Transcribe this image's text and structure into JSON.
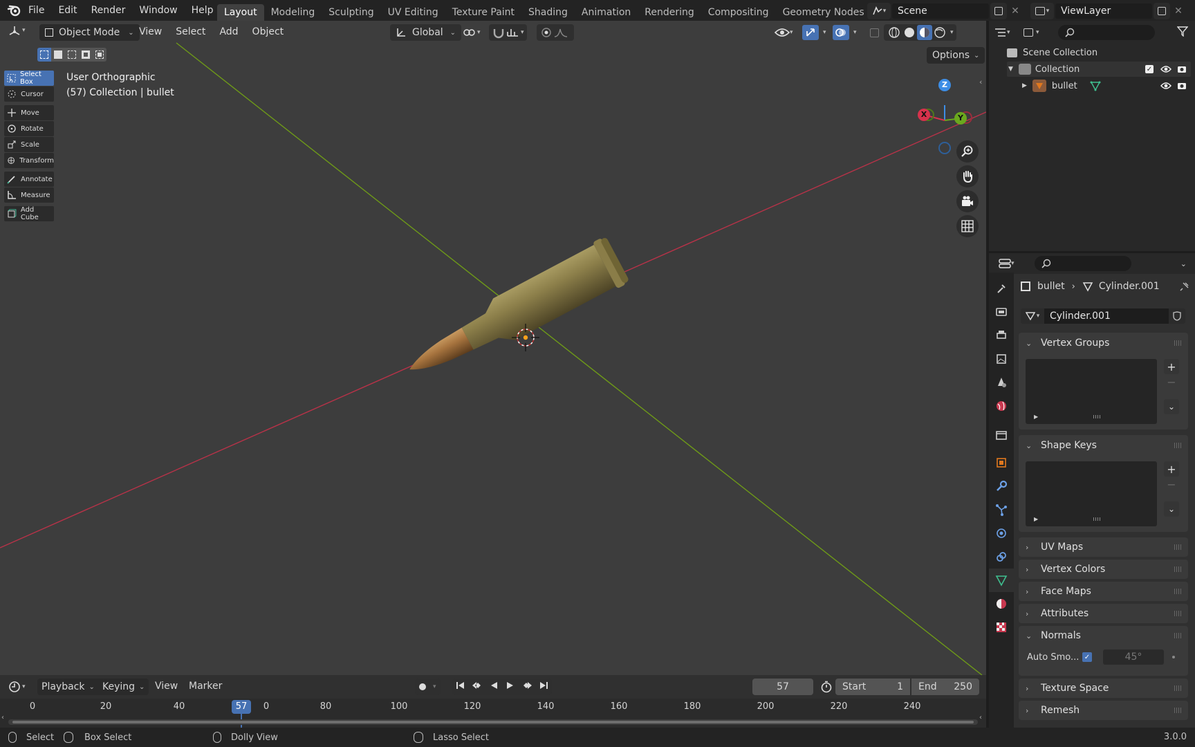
{
  "topbar": {
    "menus": [
      "File",
      "Edit",
      "Render",
      "Window",
      "Help"
    ],
    "workspaces": [
      "Layout",
      "Modeling",
      "Sculpting",
      "UV Editing",
      "Texture Paint",
      "Shading",
      "Animation",
      "Rendering",
      "Compositing",
      "Geometry Nodes",
      "S"
    ],
    "scene": "Scene",
    "view_layer": "ViewLayer"
  },
  "viewport": {
    "mode": "Object Mode",
    "menus": [
      "View",
      "Select",
      "Add",
      "Object"
    ],
    "transform_orientation": "Global",
    "options_label": "Options",
    "info_line1": "User Orthographic",
    "info_line2": "(57) Collection | bullet",
    "tools": [
      "Select Box",
      "Cursor",
      "Move",
      "Rotate",
      "Scale",
      "Transform",
      "Annotate",
      "Measure",
      "Add Cube"
    ],
    "gizmo": {
      "x": "X",
      "y": "Y",
      "z": "Z"
    }
  },
  "outliner": {
    "scene_collection": "Scene Collection",
    "collection": "Collection",
    "object": "bullet"
  },
  "properties": {
    "breadcrumb_object": "bullet",
    "breadcrumb_data": "Cylinder.001",
    "datablock": "Cylinder.001",
    "panels": {
      "vertex_groups": "Vertex Groups",
      "shape_keys": "Shape Keys",
      "uv_maps": "UV Maps",
      "vertex_colors": "Vertex Colors",
      "face_maps": "Face Maps",
      "attributes": "Attributes",
      "normals": "Normals",
      "texture_space": "Texture Space",
      "remesh": "Remesh"
    },
    "auto_smooth_label": "Auto Smo...",
    "auto_smooth_angle": "45°"
  },
  "timeline": {
    "menus": [
      "Playback",
      "Keying",
      "View",
      "Marker"
    ],
    "current_frame": "57",
    "start_label": "Start",
    "start": "1",
    "end_label": "End",
    "end": "250",
    "ticks": [
      "0",
      "20",
      "40",
      "0",
      "80",
      "100",
      "120",
      "140",
      "160",
      "180",
      "200",
      "220",
      "240"
    ]
  },
  "statusbar": {
    "select": "Select",
    "box_select": "Box Select",
    "dolly_view": "Dolly View",
    "lasso_select": "Lasso Select",
    "version": "3.0.0"
  },
  "colors": {
    "accent": "#4772b3",
    "x_axis": "#c8384f",
    "y_axis": "#6a9a1d",
    "z_axis": "#3d8ee6",
    "object_orange": "#e0781e"
  }
}
